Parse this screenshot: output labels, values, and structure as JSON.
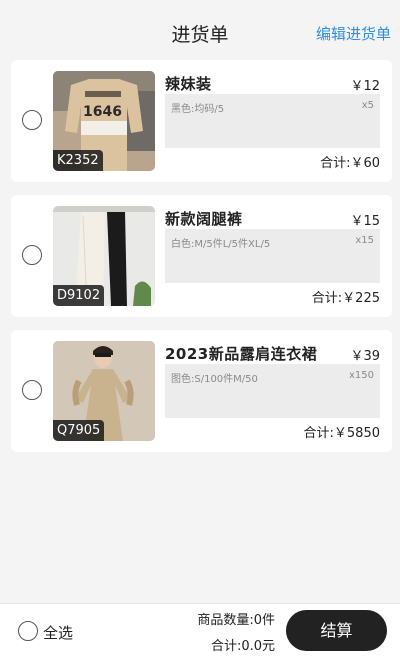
{
  "header": {
    "title": "进货单",
    "edit_label": "编辑进货单"
  },
  "items": [
    {
      "code": "K2352",
      "name": "辣妹装",
      "price": "￥12",
      "spec": "黑色:均码/5",
      "qty": "x5",
      "subtotal": "合计:￥60",
      "image_icon": "sweater-image"
    },
    {
      "code": "D9102",
      "name": "新款阔腿裤",
      "price": "￥15",
      "spec": "白色:M/5件L/5件XL/5",
      "qty": "x15",
      "subtotal": "合计:￥225",
      "image_icon": "pants-image"
    },
    {
      "code": "Q7905",
      "name": "2023新品露肩连衣裙",
      "price": "￥39",
      "spec": "图色:S/100件M/50",
      "qty": "x150",
      "subtotal": "合计:￥5850",
      "image_icon": "dress-image"
    }
  ],
  "footer": {
    "select_all_label": "全选",
    "quantity_text": "商品数量:0件",
    "total_text": "合计:0.0元",
    "checkout_label": "结算"
  }
}
